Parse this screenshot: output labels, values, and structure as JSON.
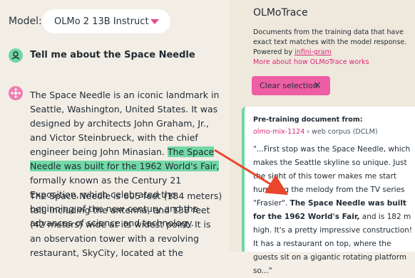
{
  "model": {
    "label": "Model:",
    "selected": "OLMo 2 13B Instruct"
  },
  "conversation": {
    "user_message": "Tell me about the Space Needle",
    "response_p1_pre": "The Space Needle is an iconic landmark in Seattle, Washington, United States. It was designed by architects John Graham, Jr., and Victor Steinbrueck, with the chief engineer being John Minasian. ",
    "response_p1_highlight": "The Space Needle was built for the 1962 World's Fair,",
    "response_p1_post": " formally known as the Century 21 Exposition, which celebrated the beginning of the new century and the advances of science and technology.",
    "response_p2": "The Space Needle is 605 feet (184 meters) tall, including the antenna, and 138 feet (42 meters) wide at its widest point. It is an observation tower with a revolving restaurant, SkyCity, located at the"
  },
  "trace": {
    "title": "OLMoTrace",
    "description": "Documents from the training data that have exact text matches with the model response. Powered by ",
    "powered_link": "infini-gram",
    "more_link": "More about how OLMoTrace works",
    "clear_button": "Clear selection",
    "clear_icon": "×"
  },
  "document": {
    "header": "Pre-training document from:",
    "source_link": "olmo-mix-1124",
    "source_sep": " › ",
    "source_rest": "web corpus (DCLM)",
    "text_pre": "\"...First stop was the Space Needle, which makes the Seattle skyline so unique. Just the sight of this tower makes me start humming the melody from the TV series \"Frasier\". ",
    "text_bold": "The Space Needle was built for the 1962 World's Fair,",
    "text_post": " and is 182 m high. It's a pretty impressive construction! It has a restaurant on top, where the guests sit on a gigantic rotating platform so...\""
  },
  "colors": {
    "highlight": "#72d8a6",
    "accent_pink": "#ee5ea4",
    "link_pink": "#d7277a",
    "arrow": "#e8472c"
  }
}
